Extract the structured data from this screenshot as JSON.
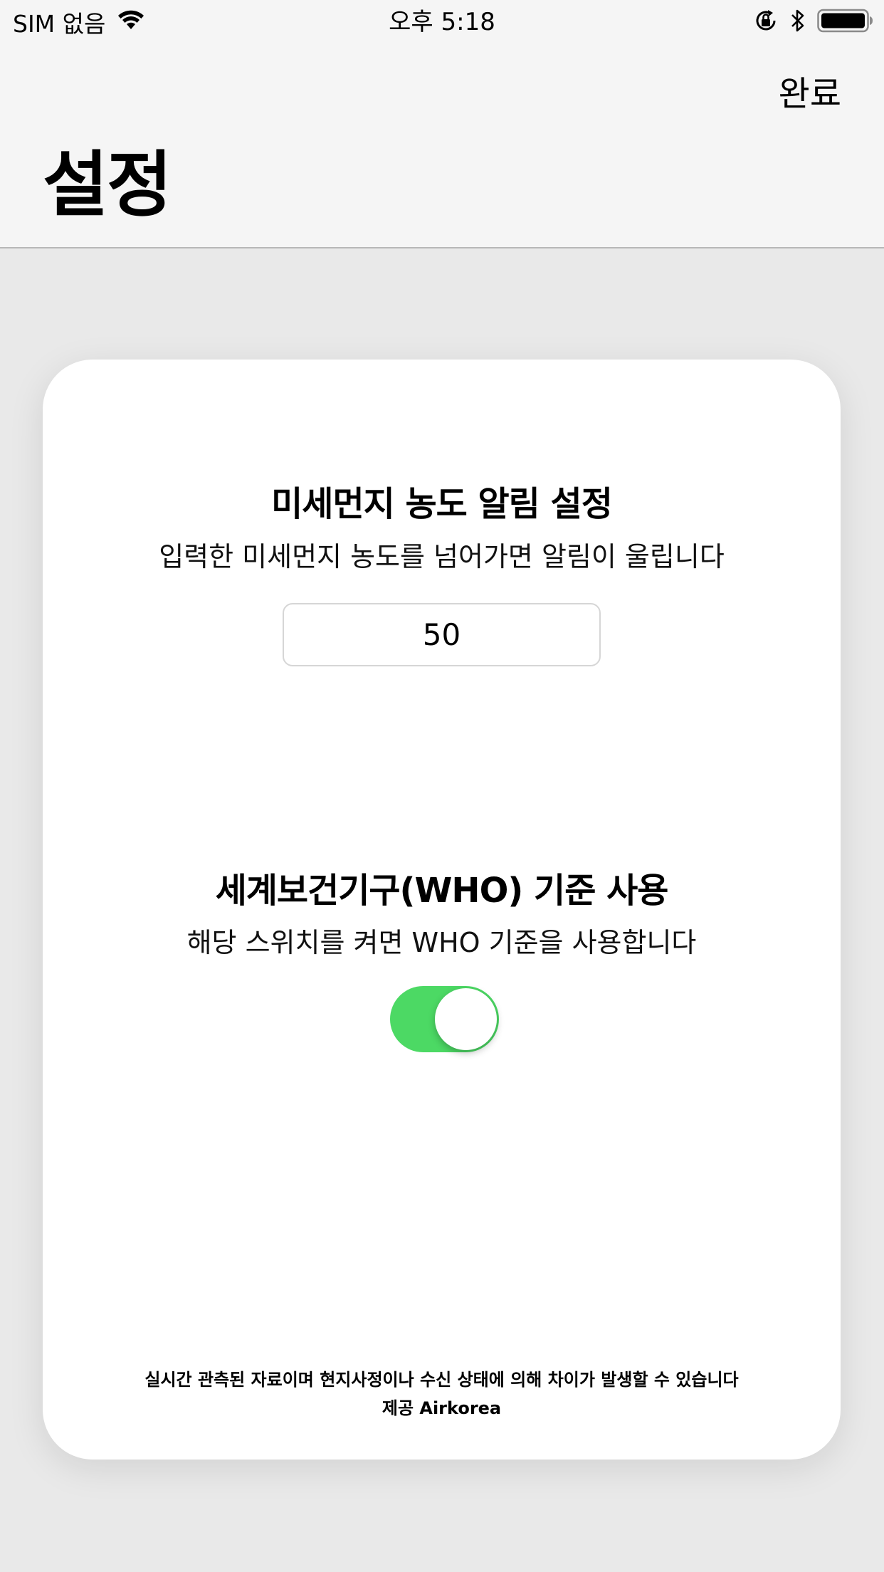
{
  "status_bar": {
    "carrier": "SIM 없음",
    "time": "오후 5:18"
  },
  "nav": {
    "done_label": "완료",
    "title": "설정"
  },
  "alert_section": {
    "title": "미세먼지 농도 알림 설정",
    "description": "입력한 미세먼지 농도를 넘어가면 알림이 울립니다",
    "threshold_value": "50"
  },
  "who_section": {
    "title": "세계보건기구(WHO) 기준 사용",
    "description": "해당 스위치를 켜면 WHO 기준을 사용합니다",
    "toggle_on": true,
    "toggle_color": "#4cd964"
  },
  "footer": {
    "disclaimer": "실시간 관측된 자료이며 현지사정이나 수신 상태에 의해 차이가 발생할 수 있습니다",
    "source": "제공 Airkorea"
  },
  "icons": [
    "wifi-icon",
    "rotation-lock-icon",
    "bluetooth-icon",
    "battery-icon"
  ]
}
